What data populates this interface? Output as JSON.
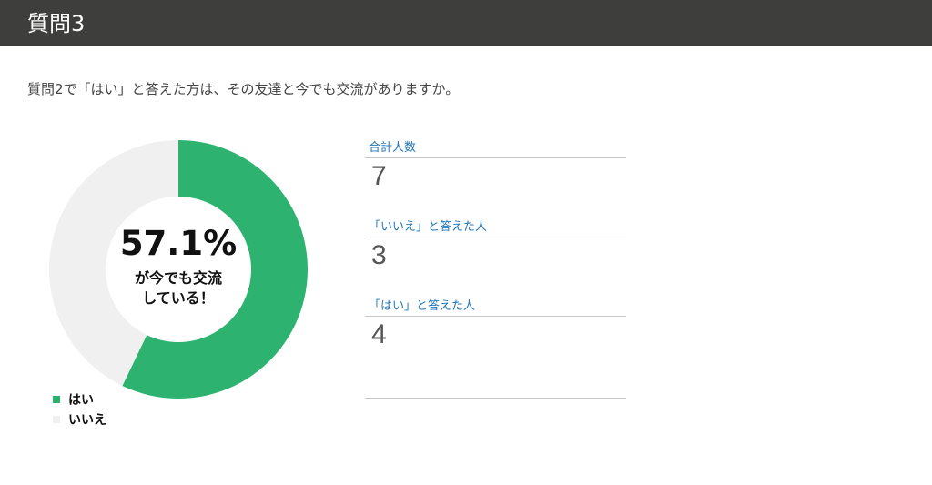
{
  "header": {
    "title": "質問3"
  },
  "question": {
    "text": "質問2で「はい」と答えた方は、その友達と今でも交流がありますか。"
  },
  "donut": {
    "center_value": "57.1%",
    "caption_line1": "が今でも交流",
    "caption_line2": "している！"
  },
  "chart_data": {
    "type": "pie",
    "categories": [
      "はい",
      "いいえ"
    ],
    "values": [
      4,
      3
    ],
    "colors": [
      "#2db36f",
      "#f0f0f0"
    ],
    "legend_position": "bottom-left"
  },
  "legend": {
    "items": [
      {
        "label": "はい",
        "color": "#2db36f"
      },
      {
        "label": "いいえ",
        "color": "#f0f0f0"
      }
    ]
  },
  "stats": [
    {
      "label": "合計人数",
      "value": "7"
    },
    {
      "label": "「いいえ」と答えた人",
      "value": "3"
    },
    {
      "label": "「はい」と答えた人",
      "value": "4"
    }
  ]
}
